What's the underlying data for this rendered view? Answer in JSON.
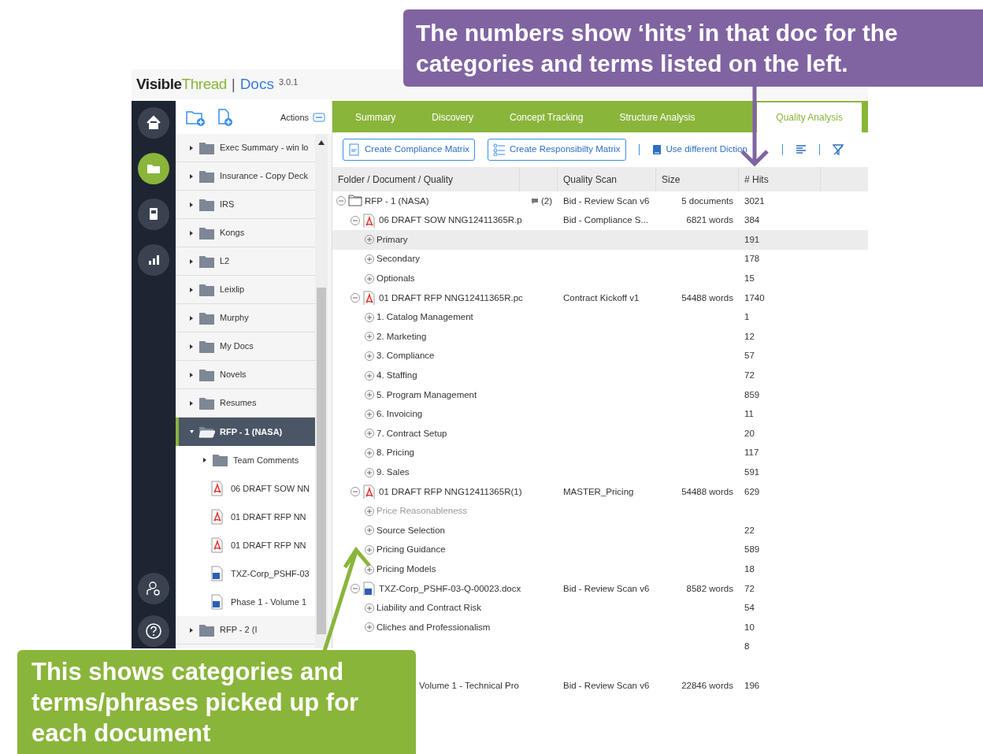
{
  "header": {
    "brand_first": "Visible",
    "brand_second": "Thread",
    "separator": "|",
    "product": "Docs",
    "version": "3.0.1"
  },
  "rail": [
    {
      "kind": "home",
      "selected": false
    },
    {
      "kind": "folder",
      "selected": true
    },
    {
      "kind": "book",
      "selected": false
    },
    {
      "kind": "chart",
      "selected": false
    }
  ],
  "rail_bottom": [
    {
      "kind": "user-settings"
    },
    {
      "kind": "help"
    }
  ],
  "folder_panel": {
    "actions_label": "Actions",
    "items": [
      {
        "kind": "folder",
        "label": "Exec Summary - win lo",
        "expanded": false,
        "selected": false
      },
      {
        "kind": "folder",
        "label": "Insurance - Copy Deck",
        "expanded": false,
        "selected": false
      },
      {
        "kind": "folder",
        "label": "IRS",
        "expanded": false,
        "selected": false
      },
      {
        "kind": "folder",
        "label": "Kongs",
        "expanded": false,
        "selected": false
      },
      {
        "kind": "folder",
        "label": "L2",
        "expanded": false,
        "selected": false
      },
      {
        "kind": "folder",
        "label": "Leixlip",
        "expanded": false,
        "selected": false
      },
      {
        "kind": "folder",
        "label": "Murphy",
        "expanded": false,
        "selected": false
      },
      {
        "kind": "folder",
        "label": "My Docs",
        "expanded": false,
        "selected": false
      },
      {
        "kind": "folder",
        "label": "Novels",
        "expanded": false,
        "selected": false
      },
      {
        "kind": "folder",
        "label": "Resumes",
        "expanded": false,
        "selected": false
      },
      {
        "kind": "folder",
        "label": "RFP - 1 (NASA)",
        "expanded": true,
        "selected": true,
        "children": [
          {
            "kind": "folder",
            "label": "Team Comments",
            "expanded": false,
            "selected": false
          },
          {
            "kind": "pdf",
            "label": "06 DRAFT SOW NN",
            "selected": false
          },
          {
            "kind": "pdf",
            "label": "01 DRAFT RFP NN",
            "selected": false
          },
          {
            "kind": "pdf",
            "label": "01 DRAFT RFP NN",
            "selected": false
          },
          {
            "kind": "word",
            "label": "TXZ-Corp_PSHF-03",
            "selected": false
          },
          {
            "kind": "word",
            "label": "Phase 1 - Volume 1",
            "selected": false
          }
        ]
      },
      {
        "kind": "folder",
        "label": "RFP - 2 (I",
        "expanded": false,
        "selected": false
      }
    ]
  },
  "tabs": [
    {
      "label": "Summary",
      "selected": false
    },
    {
      "label": "Discovery",
      "selected": false
    },
    {
      "label": "Concept Tracking",
      "selected": false
    },
    {
      "label": "Structure Analysis",
      "selected": false
    },
    {
      "label": "Quality Analysis",
      "selected": true
    }
  ],
  "toolbar": {
    "buttons": [
      "Create Compliance Matrix",
      "Create Responsibilty Matrix"
    ],
    "dictionary_link": "Use different Diction"
  },
  "table": {
    "columns": [
      "Folder / Document / Quality",
      "",
      "Quality Scan",
      "Size",
      "# Hits"
    ],
    "rows": [
      {
        "kind": "folder",
        "name": "RFP - 1 (NASA)",
        "comments": "(2)",
        "scan": "Bid - Review Scan v6",
        "size": "5 documents",
        "hits": "3021",
        "expanded": true,
        "children": [
          {
            "kind": "pdf",
            "name": "06 DRAFT SOW NNG12411365R.p",
            "scan": "Bid - Compliance S...",
            "size": "6821 words",
            "hits": "384",
            "expanded": true,
            "children": [
              {
                "kind": "category",
                "name": "Primary",
                "hits": "191",
                "selected": true,
                "disabled": false
              },
              {
                "kind": "category",
                "name": "Secondary",
                "hits": "178",
                "selected": false,
                "disabled": false
              },
              {
                "kind": "category",
                "name": "Optionals",
                "hits": "15",
                "selected": false,
                "disabled": false
              }
            ]
          },
          {
            "kind": "pdf",
            "name": "01 DRAFT RFP NNG12411365R.pc",
            "scan": "Contract Kickoff v1",
            "size": "54488 words",
            "hits": "1740",
            "expanded": true,
            "children": [
              {
                "kind": "category",
                "name": "1. Catalog Management",
                "hits": "1",
                "selected": false,
                "disabled": false
              },
              {
                "kind": "category",
                "name": "2. Marketing",
                "hits": "12",
                "selected": false,
                "disabled": false
              },
              {
                "kind": "category",
                "name": "3. Compliance",
                "hits": "57",
                "selected": false,
                "disabled": false
              },
              {
                "kind": "category",
                "name": "4. Staffing",
                "hits": "72",
                "selected": false,
                "disabled": false
              },
              {
                "kind": "category",
                "name": "5. Program Management",
                "hits": "859",
                "selected": false,
                "disabled": false
              },
              {
                "kind": "category",
                "name": "6. Invoicing",
                "hits": "11",
                "selected": false,
                "disabled": false
              },
              {
                "kind": "category",
                "name": "7. Contract Setup",
                "hits": "20",
                "selected": false,
                "disabled": false
              },
              {
                "kind": "category",
                "name": "8. Pricing",
                "hits": "117",
                "selected": false,
                "disabled": false
              },
              {
                "kind": "category",
                "name": "9. Sales",
                "hits": "591",
                "selected": false,
                "disabled": false
              }
            ]
          },
          {
            "kind": "pdf",
            "name": "01 DRAFT RFP NNG12411365R(1)",
            "scan": "MASTER_Pricing",
            "size": "54488 words",
            "hits": "629",
            "expanded": true,
            "children": [
              {
                "kind": "category",
                "name": "Price Reasonableness",
                "selected": false,
                "disabled": true
              },
              {
                "kind": "category",
                "name": "Source Selection",
                "hits": "22",
                "selected": false,
                "disabled": false
              },
              {
                "kind": "category",
                "name": "Pricing Guidance",
                "hits": "589",
                "selected": false,
                "disabled": false
              },
              {
                "kind": "category",
                "name": "Pricing Models",
                "hits": "18",
                "selected": false,
                "disabled": false
              }
            ]
          },
          {
            "kind": "word",
            "name": "TXZ-Corp_PSHF-03-Q-00023.docx",
            "scan": "Bid - Review Scan v6",
            "size": "8582 words",
            "hits": "72",
            "expanded": true,
            "children": [
              {
                "kind": "category",
                "name": "Liability and Contract Risk",
                "hits": "54",
                "selected": false,
                "disabled": false
              },
              {
                "kind": "category",
                "name": "Cliches and Professionalism",
                "hits": "10",
                "selected": false,
                "disabled": false
              },
              {
                "kind": "covered",
                "hits": "8"
              }
            ]
          },
          {
            "kind": "covered_document",
            "name": "Volume 1 - Technical Pro",
            "scan": "Bid - Review Scan v6",
            "size": "22846 words",
            "hits": "196"
          }
        ]
      }
    ]
  },
  "callouts": [
    {
      "kind": "top_right",
      "text": "The numbers show ‘hits’ in that doc for the categories and terms listed on the left."
    },
    {
      "kind": "bottom_left",
      "text": "This shows categories and terms/phrases picked up for each document"
    }
  ]
}
